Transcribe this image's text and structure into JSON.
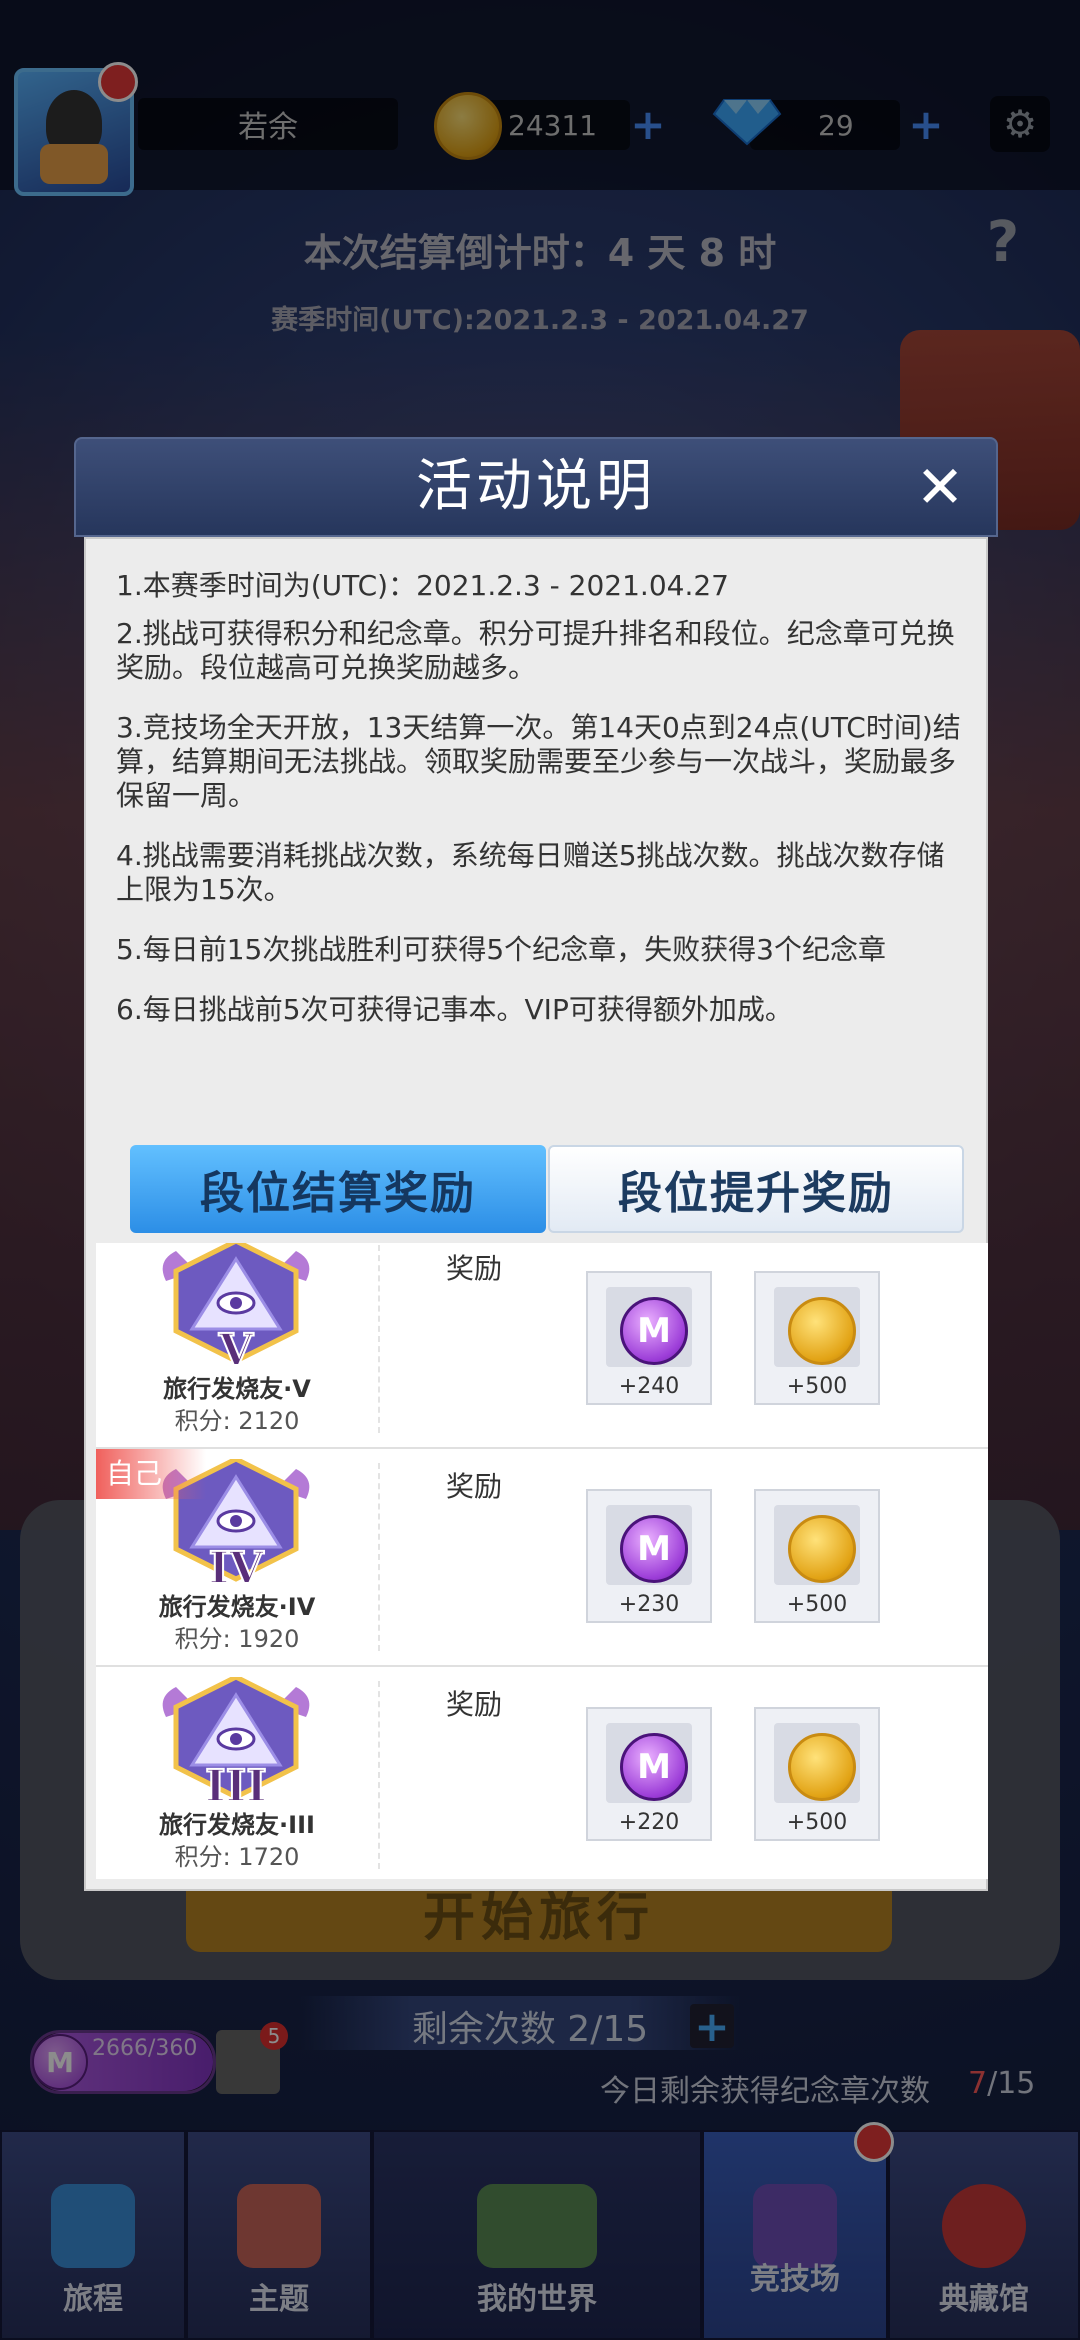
{
  "topbar": {
    "player_name": "若余",
    "coins": "24311",
    "gems": "29"
  },
  "season": {
    "countdown": "本次结算倒计时：4 天 8 时",
    "season_time": "赛季时间(UTC):2021.2.3 - 2021.04.27"
  },
  "modal": {
    "title": "活动说明",
    "close_icon": "close-icon",
    "rules": [
      "1.本赛季时间为(UTC)：2021.2.3  -  2021.04.27",
      "2.挑战可获得积分和纪念章。积分可提升排名和段位。纪念章可兑换奖励。段位越高可兑换奖励越多。",
      "3.竞技场全天开放，13天结算一次。第14天0点到24点(UTC时间)结算，结算期间无法挑战。领取奖励需要至少参与一次战斗，奖励最多保留一周。",
      "4.挑战需要消耗挑战次数，系统每日赠送5挑战次数。挑战次数存储上限为15次。",
      "5.每日前15次挑战胜利可获得5个纪念章，失败获得3个纪念章",
      "6.每日挑战前5次可获得记事本。VIP可获得额外加成。"
    ],
    "tabs": [
      {
        "label": "段位结算奖励",
        "active": true
      },
      {
        "label": "段位提升奖励",
        "active": false
      }
    ],
    "reward_rows": [
      {
        "numeral": "V",
        "name": "旅行发烧友·V",
        "score": "积分: 2120",
        "reward_label": "奖励",
        "self_tag": "",
        "items": [
          {
            "type": "medal",
            "value": "+240"
          },
          {
            "type": "coin",
            "value": "+500"
          }
        ]
      },
      {
        "numeral": "IV",
        "name": "旅行发烧友·IV",
        "score": "积分: 1920",
        "reward_label": "奖励",
        "self_tag": "自己",
        "items": [
          {
            "type": "medal",
            "value": "+230"
          },
          {
            "type": "coin",
            "value": "+500"
          }
        ]
      },
      {
        "numeral": "III",
        "name": "旅行发烧友·III",
        "score": "积分: 1720",
        "reward_label": "奖励",
        "self_tag": "",
        "items": [
          {
            "type": "medal",
            "value": "+220"
          },
          {
            "type": "coin",
            "value": "+500"
          }
        ]
      }
    ]
  },
  "game": {
    "start_button": "开始旅行",
    "remaining": "剩余次数  2/15",
    "medal_progress_text": "2666/360",
    "medal_progress_fraction": 1.0,
    "notebook_badge": "5",
    "today_label": "今日剩余获得纪念章次数",
    "today_used": "7",
    "today_total": "/15"
  },
  "nav": {
    "items": [
      {
        "label": "旅程",
        "icon": "journey-icon"
      },
      {
        "label": "主题",
        "icon": "theme-house-icon"
      },
      {
        "label": "我的世界",
        "icon": "world-icon"
      },
      {
        "label": "竞技场",
        "icon": "arena-shield-icon"
      },
      {
        "label": "典藏馆",
        "icon": "collection-medal-icon"
      }
    ]
  },
  "colors": {
    "tab_active": "#2c8ee6",
    "coin": "#e2a315",
    "medal": "#9c3dd8",
    "self_tag": "#f0605c"
  }
}
